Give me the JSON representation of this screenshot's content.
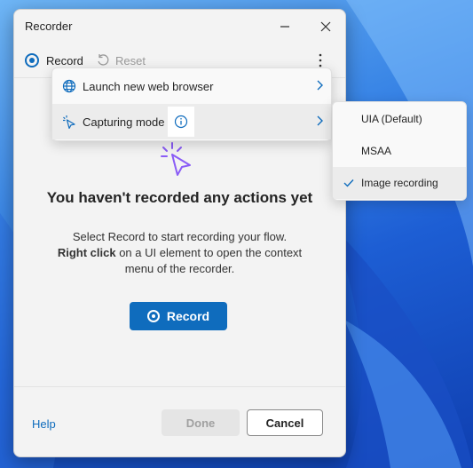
{
  "window": {
    "title": "Recorder"
  },
  "toolbar": {
    "record_label": "Record",
    "reset_label": "Reset"
  },
  "main": {
    "headline": "You haven't recorded any actions yet",
    "line1": "Select Record to start recording your flow.",
    "line2_bold": "Right click",
    "line2_rest": " on a UI element to open the context",
    "line3": "menu of the recorder.",
    "record_button": "Record"
  },
  "menu": {
    "launch_browser": "Launch new web browser",
    "capturing_mode": "Capturing mode"
  },
  "submenu": {
    "items": [
      "UIA (Default)",
      "MSAA",
      "Image recording"
    ],
    "selected_index": 2
  },
  "footer": {
    "help": "Help",
    "done": "Done",
    "cancel": "Cancel"
  },
  "colors": {
    "accent": "#0f6cbd",
    "illustration": "#8a5cf6"
  }
}
